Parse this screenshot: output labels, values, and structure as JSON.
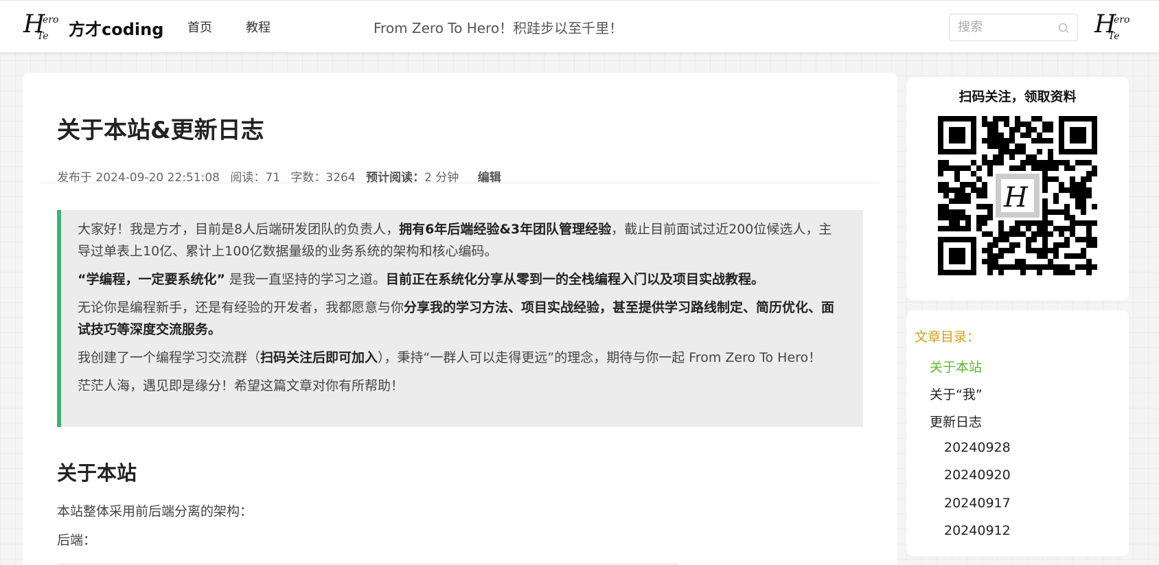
{
  "header": {
    "logo": {
      "big": "H",
      "sm1": "ero",
      "sm2": "Te"
    },
    "site_name": "方才coding",
    "nav": [
      "首页",
      "教程"
    ],
    "slogan": "From Zero To Hero！积跬步以至千里！",
    "search_placeholder": "搜索",
    "avatar": {
      "big": "H",
      "sm1": "ero",
      "sm2": "Te"
    }
  },
  "article": {
    "title": "关于本站&更新日志",
    "meta": {
      "published_label": "发布于",
      "published": "2024-09-20 22:51:08",
      "reads_label": "阅读：",
      "reads": "71",
      "words_label": "字数：",
      "words": "3264",
      "est_label": "预计阅读：",
      "est": "2 分钟",
      "edit": "编辑"
    },
    "quote": {
      "p1_a": "大家好！我是方才，目前是8人后端研发团队的负责人，",
      "p1_b": "拥有6年后端经验&3年团队管理经验",
      "p1_c": "，截止目前面试过近200位候选人，主导过单表上10亿、累计上100亿数据量级的业务系统的架构和核心编码。",
      "p2_a": "“学编程，一定要系统化”",
      "p2_b": " 是我一直坚持的学习之道。",
      "p2_c": "目前正在系统化分享从零到一的全栈编程入门以及项目实战教程。",
      "p3_a": "无论你是编程新手，还是有经验的开发者，我都愿意与你",
      "p3_b": "分享我的学习方法、项目实战经验，甚至提供学习路线制定、简历优化、面试技巧等深度交流服务。",
      "p4_a": "我创建了一个编程学习交流群（",
      "p4_b": "扫码关注后即可加入",
      "p4_c": "），秉持“一群人可以走得更远”的理念，期待与你一起 From Zero To Hero！",
      "p5": "茫茫人海，遇见即是缘分！希望这篇文章对你有所帮助！"
    },
    "section_title": "关于本站",
    "para1": "本站整体采用前后端分离的架构：",
    "para2": "后端："
  },
  "sidebar": {
    "qr_title": "扫码关注，领取资料",
    "toc_heading": "文章目录：",
    "toc": [
      {
        "label": "关于本站",
        "level": 1,
        "active": true
      },
      {
        "label": "关于“我”",
        "level": 1,
        "active": false
      },
      {
        "label": "更新日志",
        "level": 1,
        "active": false
      },
      {
        "label": "20240928",
        "level": 2,
        "active": false
      },
      {
        "label": "20240920",
        "level": 2,
        "active": false
      },
      {
        "label": "20240917",
        "level": 2,
        "active": false
      },
      {
        "label": "20240912",
        "level": 2,
        "active": false
      }
    ]
  },
  "colors": {
    "accent_green": "#3cb371",
    "toc_active": "#5cb82e",
    "toc_heading": "#d4a017"
  }
}
